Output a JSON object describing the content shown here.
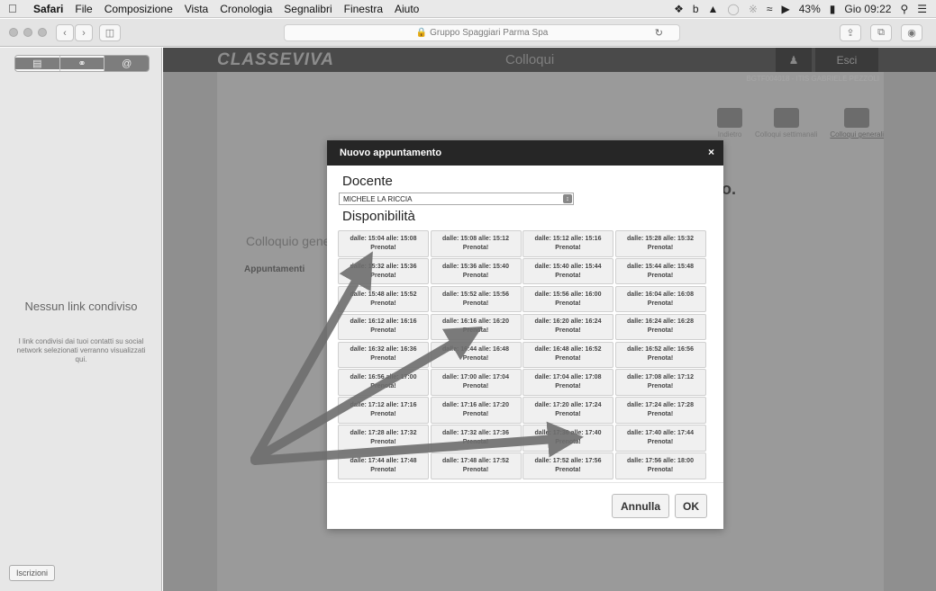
{
  "menubar": {
    "apple": "",
    "items": [
      "Safari",
      "File",
      "Composizione",
      "Vista",
      "Cronologia",
      "Segnalibri",
      "Finestra",
      "Aiuto"
    ],
    "battery": "43%",
    "clock": "Gio 09:22"
  },
  "toolbar": {
    "url": "Gruppo Spaggiari Parma Spa"
  },
  "sidebar": {
    "title": "Nessun link condiviso",
    "description": "I link condivisi dai tuoi contatti su social network selezionati verranno visualizzati qui.",
    "subscriptions_button": "Iscrizioni"
  },
  "site": {
    "logo": "CLASSEVIVA",
    "title": "Colloqui",
    "logout": "Esci",
    "school_line": "BGTF004018 - ITIS    GABRIELE PEZZOLI",
    "nav": [
      {
        "label": "Indietro"
      },
      {
        "label": "Colloqui settimanali"
      },
      {
        "label": "Colloqui generali"
      }
    ],
    "section_title": "Colloquio genera",
    "appointments_label": "Appuntamenti",
    "bg_fragment": "o."
  },
  "modal": {
    "title": "Nuovo appuntamento",
    "close": "×",
    "teacher_label": "Docente",
    "teacher_value": "MICHELE LA RICCIA",
    "availability_label": "Disponibilità",
    "slot_action": "Prenota!",
    "slots": [
      "dalle: 15:04 alle: 15:08",
      "dalle: 15:08 alle: 15:12",
      "dalle: 15:12 alle: 15:16",
      "dalle: 15:28 alle: 15:32",
      "dalle: 15:32 alle: 15:36",
      "dalle: 15:36 alle: 15:40",
      "dalle: 15:40 alle: 15:44",
      "dalle: 15:44 alle: 15:48",
      "dalle: 15:48 alle: 15:52",
      "dalle: 15:52 alle: 15:56",
      "dalle: 15:56 alle: 16:00",
      "dalle: 16:04 alle: 16:08",
      "dalle: 16:12 alle: 16:16",
      "dalle: 16:16 alle: 16:20",
      "dalle: 16:20 alle: 16:24",
      "dalle: 16:24 alle: 16:28",
      "dalle: 16:32 alle: 16:36",
      "dalle: 16:44 alle: 16:48",
      "dalle: 16:48 alle: 16:52",
      "dalle: 16:52 alle: 16:56",
      "dalle: 16:56 alle: 17:00",
      "dalle: 17:00 alle: 17:04",
      "dalle: 17:04 alle: 17:08",
      "dalle: 17:08 alle: 17:12",
      "dalle: 17:12 alle: 17:16",
      "dalle: 17:16 alle: 17:20",
      "dalle: 17:20 alle: 17:24",
      "dalle: 17:24 alle: 17:28",
      "dalle: 17:28 alle: 17:32",
      "dalle: 17:32 alle: 17:36",
      "dalle: 17:36 alle: 17:40",
      "dalle: 17:40 alle: 17:44",
      "dalle: 17:44 alle: 17:48",
      "dalle: 17:48 alle: 17:52",
      "dalle: 17:52 alle: 17:56",
      "dalle: 17:56 alle: 18:00"
    ],
    "cancel_label": "Annulla",
    "ok_label": "OK"
  },
  "colors": {
    "modal_header": "#262626",
    "overlay": "#8f8f8f",
    "annotation_arrow": "#6e6e6e"
  }
}
